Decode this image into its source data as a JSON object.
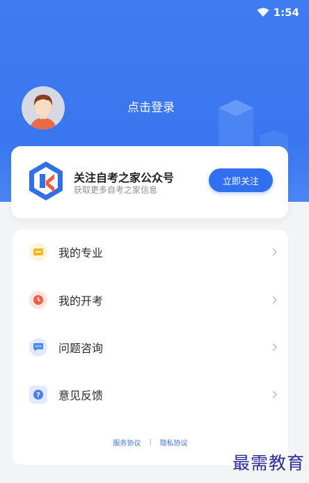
{
  "status_bar": {
    "time": "1:54",
    "wifi_icon": "wifi-icon"
  },
  "profile": {
    "login_label": "点击登录",
    "avatar_icon": "avatar"
  },
  "follow_card": {
    "title": "关注自考之家公众号",
    "subtitle": "获取更多自考之家信息",
    "button_label": "立即关注",
    "logo_icon": "brand-logo-icon"
  },
  "menu": {
    "items": [
      {
        "label": "我的专业",
        "icon": "folder-icon",
        "icon_bg": "#fff4d6",
        "icon_color": "#f5b72a"
      },
      {
        "label": "我的开考",
        "icon": "clock-icon",
        "icon_bg": "#fde3de",
        "icon_color": "#ef6146"
      },
      {
        "label": "问题咨询",
        "icon": "chat-bubble-icon",
        "icon_bg": "#dfeaff",
        "icon_color": "#4d8af2"
      },
      {
        "label": "意见反馈",
        "icon": "question-icon",
        "icon_bg": "#e1eaff",
        "icon_color": "#4a7ff0"
      }
    ]
  },
  "footer": {
    "service_agreement": "服务协议",
    "separator": "|",
    "privacy_agreement": "隐私协议"
  },
  "watermark": "最需教育",
  "colors": {
    "primary": "#2f6ff0",
    "header_bg": "#3f7bf1",
    "page_bg": "#f3f4f6"
  }
}
